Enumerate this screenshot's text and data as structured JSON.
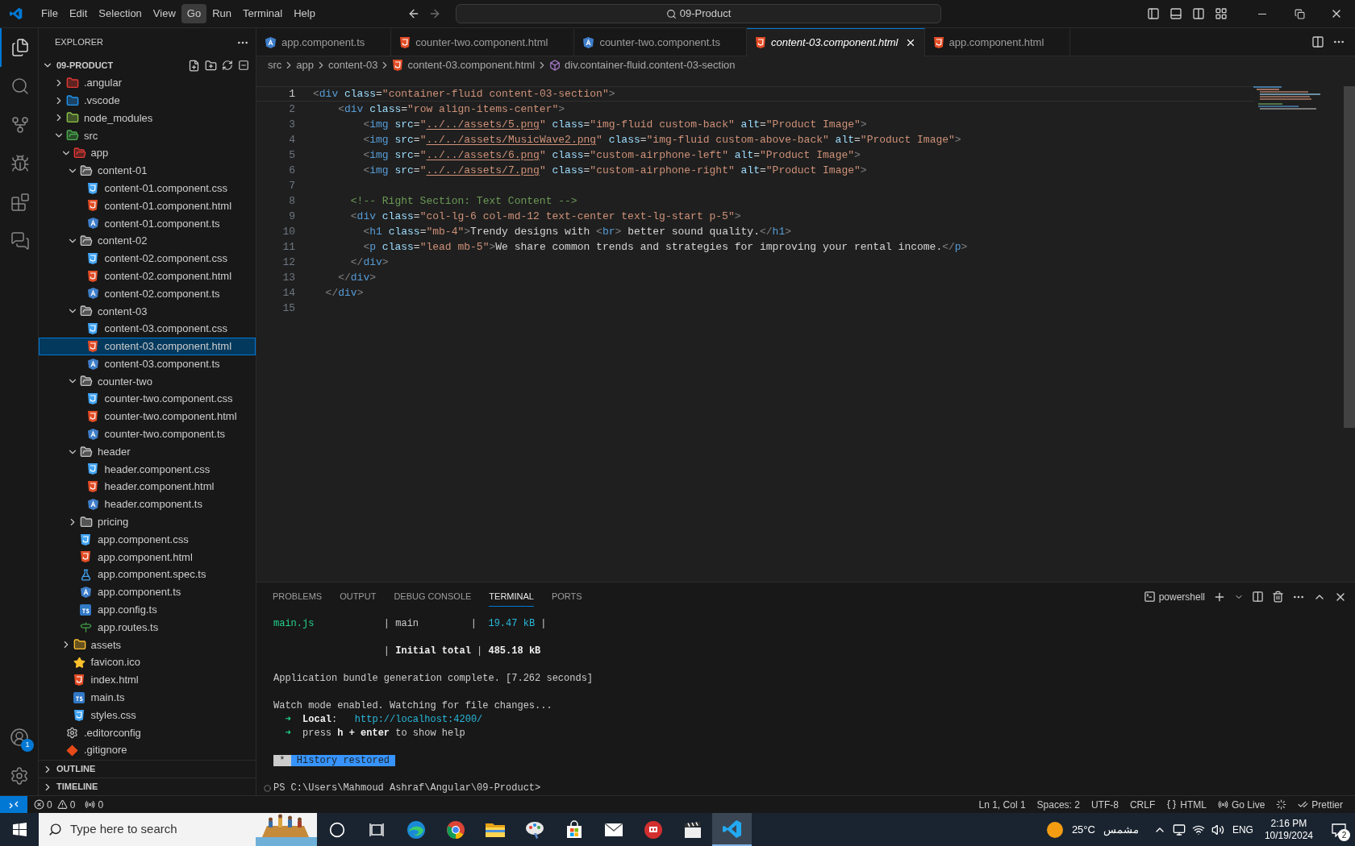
{
  "title_bar": {
    "menu": [
      {
        "label": "File",
        "selected": false
      },
      {
        "label": "Edit",
        "selected": false
      },
      {
        "label": "Selection",
        "selected": false
      },
      {
        "label": "View",
        "selected": false
      },
      {
        "label": "Go",
        "selected": true
      },
      {
        "label": "Run",
        "selected": false
      },
      {
        "label": "Terminal",
        "selected": false
      },
      {
        "label": "Help",
        "selected": false
      }
    ],
    "search": "09-Product"
  },
  "activity_bar": {
    "items": [
      {
        "kind": "explorer",
        "selected": true
      },
      {
        "kind": "search",
        "selected": false
      },
      {
        "kind": "source-control",
        "selected": false
      },
      {
        "kind": "run-debug",
        "selected": false
      },
      {
        "kind": "extensions",
        "selected": false
      },
      {
        "kind": "remote",
        "selected": false
      }
    ],
    "account_badge": "1"
  },
  "sidebar": {
    "title": "EXPLORER",
    "root": {
      "label": "09-PRODUCT",
      "expanded": true,
      "children": [
        {
          "label": ".angular",
          "kind": "folder-angular",
          "expanded": false,
          "selected": false
        },
        {
          "label": ".vscode",
          "kind": "folder-vscode",
          "expanded": false,
          "selected": false
        },
        {
          "label": "node_modules",
          "kind": "folder-node",
          "expanded": false,
          "selected": false
        },
        {
          "label": "src",
          "kind": "folder-src",
          "expanded": true,
          "selected": false,
          "children": [
            {
              "label": "app",
              "kind": "folder-app",
              "expanded": true,
              "selected": false,
              "children": [
                {
                  "label": "content-01",
                  "kind": "folder",
                  "expanded": true,
                  "selected": false,
                  "children": [
                    {
                      "label": "content-01.component.css",
                      "kind": "css",
                      "selected": false
                    },
                    {
                      "label": "content-01.component.html",
                      "kind": "html",
                      "selected": false
                    },
                    {
                      "label": "content-01.component.ts",
                      "kind": "angular",
                      "selected": false
                    }
                  ]
                },
                {
                  "label": "content-02",
                  "kind": "folder",
                  "expanded": true,
                  "selected": false,
                  "children": [
                    {
                      "label": "content-02.component.css",
                      "kind": "css",
                      "selected": false
                    },
                    {
                      "label": "content-02.component.html",
                      "kind": "html",
                      "selected": false
                    },
                    {
                      "label": "content-02.component.ts",
                      "kind": "angular",
                      "selected": false
                    }
                  ]
                },
                {
                  "label": "content-03",
                  "kind": "folder",
                  "expanded": true,
                  "selected": false,
                  "children": [
                    {
                      "label": "content-03.component.css",
                      "kind": "css",
                      "selected": false
                    },
                    {
                      "label": "content-03.component.html",
                      "kind": "html",
                      "selected": true
                    },
                    {
                      "label": "content-03.component.ts",
                      "kind": "angular",
                      "selected": false
                    }
                  ]
                },
                {
                  "label": "counter-two",
                  "kind": "folder",
                  "expanded": true,
                  "selected": false,
                  "children": [
                    {
                      "label": "counter-two.component.css",
                      "kind": "css",
                      "selected": false
                    },
                    {
                      "label": "counter-two.component.html",
                      "kind": "html",
                      "selected": false
                    },
                    {
                      "label": "counter-two.component.ts",
                      "kind": "angular",
                      "selected": false
                    }
                  ]
                },
                {
                  "label": "header",
                  "kind": "folder",
                  "expanded": true,
                  "selected": false,
                  "children": [
                    {
                      "label": "header.component.css",
                      "kind": "css",
                      "selected": false
                    },
                    {
                      "label": "header.component.html",
                      "kind": "html",
                      "selected": false
                    },
                    {
                      "label": "header.component.ts",
                      "kind": "angular",
                      "selected": false
                    }
                  ]
                },
                {
                  "label": "pricing",
                  "kind": "folder",
                  "expanded": false,
                  "selected": false
                },
                {
                  "label": "app.component.css",
                  "kind": "css",
                  "selected": false
                },
                {
                  "label": "app.component.html",
                  "kind": "html",
                  "selected": false
                },
                {
                  "label": "app.component.spec.ts",
                  "kind": "spec",
                  "selected": false
                },
                {
                  "label": "app.component.ts",
                  "kind": "angular",
                  "selected": false
                },
                {
                  "label": "app.config.ts",
                  "kind": "ts",
                  "selected": false
                },
                {
                  "label": "app.routes.ts",
                  "kind": "routes",
                  "selected": false
                }
              ]
            },
            {
              "label": "assets",
              "kind": "folder-assets",
              "expanded": false,
              "selected": false
            },
            {
              "label": "favicon.ico",
              "kind": "favicon",
              "selected": false
            },
            {
              "label": "index.html",
              "kind": "html",
              "selected": false
            },
            {
              "label": "main.ts",
              "kind": "ts",
              "selected": false
            },
            {
              "label": "styles.css",
              "kind": "css",
              "selected": false
            }
          ]
        },
        {
          "label": ".editorconfig",
          "kind": "editorconfig",
          "selected": false
        },
        {
          "label": ".gitignore",
          "kind": "git",
          "selected": false
        }
      ]
    },
    "sections": [
      {
        "label": "OUTLINE",
        "expanded": false
      },
      {
        "label": "TIMELINE",
        "expanded": false
      }
    ]
  },
  "editor": {
    "tabs": [
      {
        "label": "app.component.ts",
        "kind": "angular",
        "selected": false,
        "preview": false
      },
      {
        "label": "counter-two.component.html",
        "kind": "html",
        "selected": false,
        "preview": false
      },
      {
        "label": "counter-two.component.ts",
        "kind": "angular",
        "selected": false,
        "preview": false
      },
      {
        "label": "content-03.component.html",
        "kind": "html",
        "selected": true,
        "preview": true
      },
      {
        "label": "app.component.html",
        "kind": "html",
        "selected": false,
        "preview": false
      }
    ],
    "breadcrumb": [
      {
        "label": "src",
        "kind": "segment"
      },
      {
        "label": "app",
        "kind": "segment"
      },
      {
        "label": "content-03",
        "kind": "segment"
      },
      {
        "label": "content-03.component.html",
        "kind": "html"
      },
      {
        "label": "div.container-fluid.content-03-section",
        "kind": "element"
      }
    ],
    "lines": [
      {
        "number": "1",
        "current": true,
        "tokens": [
          {
            "kind": "punct",
            "text": "<"
          },
          {
            "kind": "tag",
            "text": "div"
          },
          {
            "kind": "attr",
            "text": " class"
          },
          {
            "kind": "eq",
            "text": "="
          },
          {
            "kind": "string",
            "text": "\"container-fluid content-03-section\""
          },
          {
            "kind": "punct",
            "text": ">"
          }
        ]
      },
      {
        "number": "2",
        "current": false,
        "tokens": [
          {
            "kind": "punct",
            "text": "    <"
          },
          {
            "kind": "tag",
            "text": "div"
          },
          {
            "kind": "attr",
            "text": " class"
          },
          {
            "kind": "eq",
            "text": "="
          },
          {
            "kind": "string",
            "text": "\"row align-items-center\""
          },
          {
            "kind": "punct",
            "text": ">"
          }
        ]
      },
      {
        "number": "3",
        "current": false,
        "tokens": [
          {
            "kind": "punct",
            "text": "        <"
          },
          {
            "kind": "tag",
            "text": "img"
          },
          {
            "kind": "attr",
            "text": " src"
          },
          {
            "kind": "eq",
            "text": "="
          },
          {
            "kind": "string",
            "text": "\""
          },
          {
            "kind": "link",
            "text": "../../assets/5.png"
          },
          {
            "kind": "string",
            "text": "\""
          },
          {
            "kind": "attr",
            "text": " class"
          },
          {
            "kind": "eq",
            "text": "="
          },
          {
            "kind": "string",
            "text": "\"img-fluid custom-back\""
          },
          {
            "kind": "attr",
            "text": " alt"
          },
          {
            "kind": "eq",
            "text": "="
          },
          {
            "kind": "string",
            "text": "\"Product Image\""
          },
          {
            "kind": "punct",
            "text": ">"
          }
        ]
      },
      {
        "number": "4",
        "current": false,
        "tokens": [
          {
            "kind": "punct",
            "text": "        <"
          },
          {
            "kind": "tag",
            "text": "img"
          },
          {
            "kind": "attr",
            "text": " src"
          },
          {
            "kind": "eq",
            "text": "="
          },
          {
            "kind": "string",
            "text": "\""
          },
          {
            "kind": "link",
            "text": "../../assets/MusicWave2.png"
          },
          {
            "kind": "string",
            "text": "\""
          },
          {
            "kind": "attr",
            "text": " class"
          },
          {
            "kind": "eq",
            "text": "="
          },
          {
            "kind": "string",
            "text": "\"img-fluid custom-above-back\""
          },
          {
            "kind": "attr",
            "text": " alt"
          },
          {
            "kind": "eq",
            "text": "="
          },
          {
            "kind": "string",
            "text": "\"Product Image\""
          },
          {
            "kind": "punct",
            "text": ">"
          }
        ]
      },
      {
        "number": "5",
        "current": false,
        "tokens": [
          {
            "kind": "punct",
            "text": "        <"
          },
          {
            "kind": "tag",
            "text": "img"
          },
          {
            "kind": "attr",
            "text": " src"
          },
          {
            "kind": "eq",
            "text": "="
          },
          {
            "kind": "string",
            "text": "\""
          },
          {
            "kind": "link",
            "text": "../../assets/6.png"
          },
          {
            "kind": "string",
            "text": "\""
          },
          {
            "kind": "attr",
            "text": " class"
          },
          {
            "kind": "eq",
            "text": "="
          },
          {
            "kind": "string",
            "text": "\"custom-airphone-left\""
          },
          {
            "kind": "attr",
            "text": " alt"
          },
          {
            "kind": "eq",
            "text": "="
          },
          {
            "kind": "string",
            "text": "\"Product Image\""
          },
          {
            "kind": "punct",
            "text": ">"
          }
        ]
      },
      {
        "number": "6",
        "current": false,
        "tokens": [
          {
            "kind": "punct",
            "text": "        <"
          },
          {
            "kind": "tag",
            "text": "img"
          },
          {
            "kind": "attr",
            "text": " src"
          },
          {
            "kind": "eq",
            "text": "="
          },
          {
            "kind": "string",
            "text": "\""
          },
          {
            "kind": "link",
            "text": "../../assets/7.png"
          },
          {
            "kind": "string",
            "text": "\""
          },
          {
            "kind": "attr",
            "text": " class"
          },
          {
            "kind": "eq",
            "text": "="
          },
          {
            "kind": "string",
            "text": "\"custom-airphone-right\""
          },
          {
            "kind": "attr",
            "text": " alt"
          },
          {
            "kind": "eq",
            "text": "="
          },
          {
            "kind": "string",
            "text": "\"Product Image\""
          },
          {
            "kind": "punct",
            "text": ">"
          }
        ]
      },
      {
        "number": "7",
        "current": false
      },
      {
        "number": "8",
        "current": false,
        "tokens": [
          {
            "kind": "comment",
            "text": "      <!-- Right Section: Text Content -->"
          }
        ]
      },
      {
        "number": "9",
        "current": false,
        "tokens": [
          {
            "kind": "punct",
            "text": "      <"
          },
          {
            "kind": "tag",
            "text": "div"
          },
          {
            "kind": "attr",
            "text": " class"
          },
          {
            "kind": "eq",
            "text": "="
          },
          {
            "kind": "string",
            "text": "\"col-lg-6 col-md-12 text-center text-lg-start p-5\""
          },
          {
            "kind": "punct",
            "text": ">"
          }
        ]
      },
      {
        "number": "10",
        "current": false,
        "tokens": [
          {
            "kind": "punct",
            "text": "        <"
          },
          {
            "kind": "tag",
            "text": "h1"
          },
          {
            "kind": "attr",
            "text": " class"
          },
          {
            "kind": "eq",
            "text": "="
          },
          {
            "kind": "string",
            "text": "\"mb-4\""
          },
          {
            "kind": "punct",
            "text": ">"
          },
          {
            "kind": "text",
            "text": "Trendy designs with "
          },
          {
            "kind": "punct",
            "text": "<"
          },
          {
            "kind": "tag",
            "text": "br"
          },
          {
            "kind": "punct",
            "text": ">"
          },
          {
            "kind": "text",
            "text": " better sound quality."
          },
          {
            "kind": "punct",
            "text": "</"
          },
          {
            "kind": "tag",
            "text": "h1"
          },
          {
            "kind": "punct",
            "text": ">"
          }
        ]
      },
      {
        "number": "11",
        "current": false,
        "tokens": [
          {
            "kind": "punct",
            "text": "        <"
          },
          {
            "kind": "tag",
            "text": "p"
          },
          {
            "kind": "attr",
            "text": " class"
          },
          {
            "kind": "eq",
            "text": "="
          },
          {
            "kind": "string",
            "text": "\"lead mb-5\""
          },
          {
            "kind": "punct",
            "text": ">"
          },
          {
            "kind": "text",
            "text": "We share common trends and strategies for improving your rental income."
          },
          {
            "kind": "punct",
            "text": "</"
          },
          {
            "kind": "tag",
            "text": "p"
          },
          {
            "kind": "punct",
            "text": ">"
          }
        ]
      },
      {
        "number": "12",
        "current": false,
        "tokens": [
          {
            "kind": "punct",
            "text": "      </"
          },
          {
            "kind": "tag",
            "text": "div"
          },
          {
            "kind": "punct",
            "text": ">"
          }
        ]
      },
      {
        "number": "13",
        "current": false,
        "tokens": [
          {
            "kind": "punct",
            "text": "    </"
          },
          {
            "kind": "tag",
            "text": "div"
          },
          {
            "kind": "punct",
            "text": ">"
          }
        ]
      },
      {
        "number": "14",
        "current": false,
        "tokens": [
          {
            "kind": "punct",
            "text": "  </"
          },
          {
            "kind": "tag",
            "text": "div"
          },
          {
            "kind": "punct",
            "text": ">"
          }
        ]
      },
      {
        "number": "15",
        "current": false
      }
    ]
  },
  "panel": {
    "tabs": [
      {
        "label": "PROBLEMS",
        "selected": false
      },
      {
        "label": "OUTPUT",
        "selected": false
      },
      {
        "label": "DEBUG CONSOLE",
        "selected": false
      },
      {
        "label": "TERMINAL",
        "selected": true
      },
      {
        "label": "PORTS",
        "selected": false
      }
    ],
    "profile": "powershell",
    "lines": [
      {
        "kind": "text",
        "segments": [
          {
            "kind": "green",
            "text": "main.js"
          },
          {
            "kind": "plain",
            "text": "            | main         |  "
          },
          {
            "kind": "cyan",
            "text": "19.47 kB"
          },
          {
            "kind": "plain",
            "text": " |"
          }
        ]
      },
      {
        "kind": "blank"
      },
      {
        "kind": "text",
        "segments": [
          {
            "kind": "plain",
            "text": "                   | "
          },
          {
            "kind": "bold",
            "text": "Initial total"
          },
          {
            "kind": "plain",
            "text": " | "
          },
          {
            "kind": "bold",
            "text": "485.18 kB"
          }
        ]
      },
      {
        "kind": "blank"
      },
      {
        "kind": "text",
        "segments": [
          {
            "kind": "plain",
            "text": "Application bundle generation complete. [7.262 seconds]"
          }
        ]
      },
      {
        "kind": "blank"
      },
      {
        "kind": "text",
        "segments": [
          {
            "kind": "plain",
            "text": "Watch mode enabled. Watching for file changes..."
          }
        ]
      },
      {
        "kind": "text",
        "segments": [
          {
            "kind": "green",
            "text": "  ➜  "
          },
          {
            "kind": "bold",
            "text": "Local"
          },
          {
            "kind": "plain",
            "text": ":   "
          },
          {
            "kind": "cyan",
            "text": "http://localhost:4200/"
          }
        ]
      },
      {
        "kind": "text",
        "segments": [
          {
            "kind": "green",
            "text": "  ➜  "
          },
          {
            "kind": "plain",
            "text": "press "
          },
          {
            "kind": "bold",
            "text": "h + enter"
          },
          {
            "kind": "plain",
            "text": " to show help"
          }
        ]
      },
      {
        "kind": "blank"
      },
      {
        "kind": "text",
        "segments": [
          {
            "kind": "badge-gray",
            "text": " * "
          },
          {
            "kind": "badge-blue",
            "text": " History restored "
          }
        ]
      },
      {
        "kind": "blank"
      },
      {
        "kind": "prompt",
        "text": "PS C:\\Users\\Mahmoud Ashraf\\Angular\\09-Product>"
      }
    ]
  },
  "status_bar": {
    "errors": "0",
    "warnings": "0",
    "ports": "0",
    "items": [
      {
        "kind": "text",
        "label": "Ln 1, Col 1"
      },
      {
        "kind": "text",
        "label": "Spaces: 2"
      },
      {
        "kind": "text",
        "label": "UTF-8"
      },
      {
        "kind": "text",
        "label": "CRLF"
      },
      {
        "kind": "braces",
        "label": "HTML"
      },
      {
        "kind": "broadcast",
        "label": "Go Live"
      },
      {
        "kind": "spinner"
      },
      {
        "kind": "check",
        "label": "Prettier"
      }
    ]
  },
  "taskbar": {
    "search_placeholder": "Type here to search",
    "apps": [
      {
        "kind": "cortana",
        "selected": false
      },
      {
        "kind": "taskview",
        "selected": false
      },
      {
        "kind": "edge",
        "selected": false
      },
      {
        "kind": "chrome",
        "selected": false
      },
      {
        "kind": "explorer",
        "selected": false
      },
      {
        "kind": "paint",
        "selected": false
      },
      {
        "kind": "store",
        "selected": false
      },
      {
        "kind": "mail",
        "selected": false
      },
      {
        "kind": "red",
        "selected": false
      },
      {
        "kind": "clapper",
        "selected": false
      },
      {
        "kind": "vscode",
        "selected": true
      }
    ],
    "temperature": "25°C",
    "weather": "مشمس",
    "language": "ENG",
    "time": "2:16 PM",
    "date": "10/19/2024",
    "notifications": "2"
  }
}
